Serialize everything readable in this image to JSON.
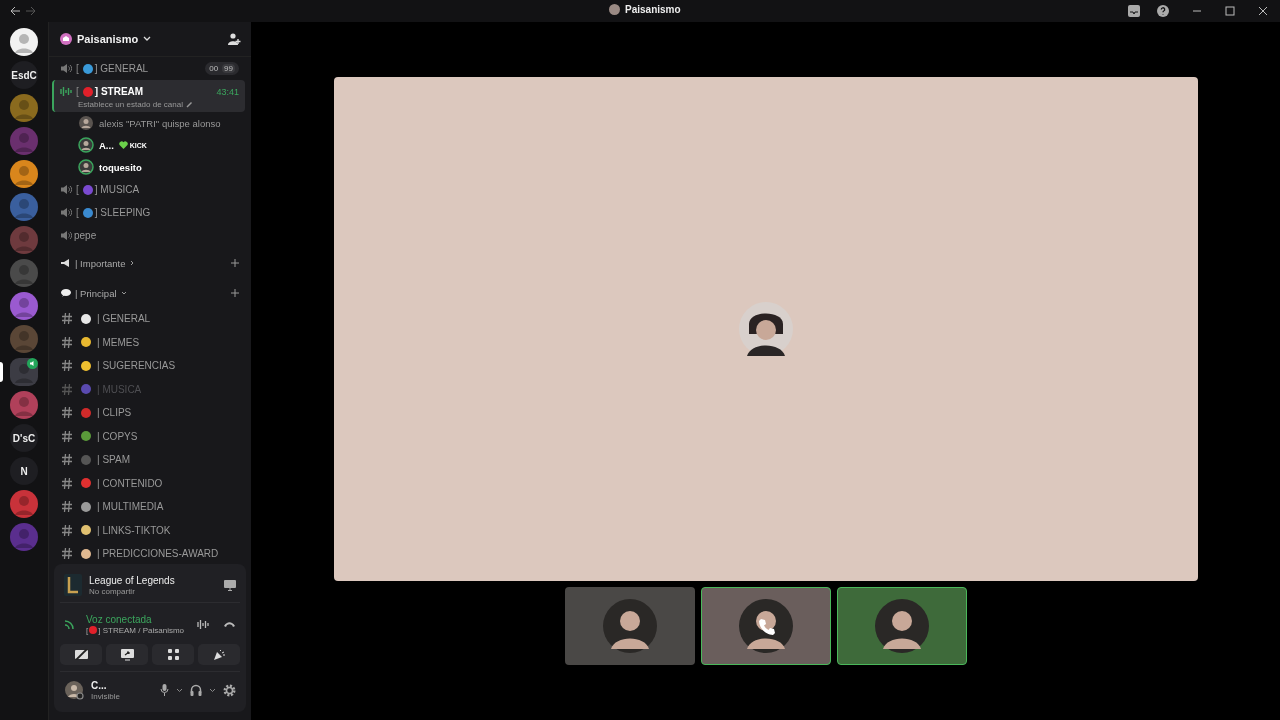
{
  "window": {
    "title": "Paisanismo"
  },
  "servers": [
    {
      "kind": "image",
      "color": "#f2f2f2",
      "selected": false,
      "in_voice": false
    },
    {
      "kind": "text",
      "label": "EsdC",
      "selected": false,
      "in_voice": false
    },
    {
      "kind": "image",
      "color": "#8a6a1e",
      "selected": false,
      "in_voice": false
    },
    {
      "kind": "image",
      "color": "#6a2f6e",
      "selected": false,
      "in_voice": false
    },
    {
      "kind": "image",
      "color": "#d9861c",
      "selected": false,
      "in_voice": false
    },
    {
      "kind": "image",
      "color": "#3a5f9e",
      "selected": false,
      "in_voice": false
    },
    {
      "kind": "image",
      "color": "#6e3a3e",
      "selected": false,
      "in_voice": false
    },
    {
      "kind": "image",
      "color": "#4a4a4a",
      "selected": false,
      "in_voice": false
    },
    {
      "kind": "image",
      "color": "#9a5ad0",
      "selected": false,
      "in_voice": false
    },
    {
      "kind": "image",
      "color": "#5a4636",
      "selected": false,
      "in_voice": false
    },
    {
      "kind": "image",
      "color": "#3c3c44",
      "selected": true,
      "in_voice": true
    },
    {
      "kind": "image",
      "color": "#b0405a",
      "selected": false,
      "in_voice": false
    },
    {
      "kind": "text",
      "label": "D'sC",
      "selected": false,
      "in_voice": false
    },
    {
      "kind": "text",
      "label": "N",
      "selected": false,
      "in_voice": false
    },
    {
      "kind": "image",
      "color": "#c8323a",
      "selected": false,
      "in_voice": false
    },
    {
      "kind": "image",
      "color": "#5a2e8e",
      "selected": false,
      "in_voice": false
    }
  ],
  "server_name": "Paisanismo",
  "voice_channels": [
    {
      "prefix": "[",
      "name": "] GENERAL",
      "color": "#3a9ad9",
      "selected": false,
      "limit": [
        "00",
        "99"
      ]
    },
    {
      "prefix": "[",
      "name": "] STREAM",
      "color": "#e0202a",
      "selected": true,
      "time": "43:41",
      "status": "Establece un estado de canal",
      "members": [
        {
          "name": "alexis \"PATRI\" quispe alonso",
          "speaking": false
        },
        {
          "name": "A...",
          "speaking": true,
          "tag": "KICK"
        },
        {
          "name": "toquesito",
          "speaking": true
        }
      ]
    },
    {
      "prefix": "[",
      "name": "] MUSICA",
      "color": "#7a4ad0",
      "selected": false
    },
    {
      "prefix": "[",
      "name": "] SLEEPING",
      "color": "#3a8ad0",
      "selected": false
    },
    {
      "name": "pepe",
      "selected": false
    }
  ],
  "categories": [
    {
      "name": "| Importante",
      "expanded": false
    },
    {
      "name": "| Principal",
      "expanded": true,
      "channels": [
        {
          "name": "| GENERAL",
          "color": "#e8e8e8",
          "muted": false
        },
        {
          "name": "| MEMES",
          "color": "#e8b830",
          "muted": false
        },
        {
          "name": "| SUGERENCIAS",
          "color": "#f0c030",
          "muted": false
        },
        {
          "name": "| MUSICA",
          "color": "#5a4ab0",
          "muted": true
        },
        {
          "name": "| CLIPS",
          "color": "#d02a2a",
          "muted": false
        },
        {
          "name": "| COPYS",
          "color": "#5a9a3a",
          "muted": false
        },
        {
          "name": "| SPAM",
          "color": "#555555",
          "muted": false
        },
        {
          "name": "| CONTENIDO",
          "color": "#e03030",
          "muted": false
        },
        {
          "name": "| MULTIMEDIA",
          "color": "#9a9a9a",
          "muted": false
        },
        {
          "name": "| LINKS-TIKTOK",
          "color": "#e0c070",
          "muted": false
        },
        {
          "name": "| PREDICCIONES-AWARD",
          "color": "#e0b890",
          "muted": false
        }
      ]
    }
  ],
  "activity": {
    "game": "League of Legends",
    "status": "No compartir"
  },
  "voice": {
    "state": "Voz conectada",
    "prefix": "[",
    "channel": "] STREAM / Paisanismo"
  },
  "user": {
    "name": "C...",
    "status": "Invisible"
  },
  "stage": {
    "tiles": [
      {
        "color": "#4a4846",
        "speaking": false,
        "calling": false
      },
      {
        "color": "#6a5e5c",
        "speaking": true,
        "calling": true
      },
      {
        "color": "#3e6a3a",
        "speaking": true,
        "calling": false
      }
    ]
  }
}
